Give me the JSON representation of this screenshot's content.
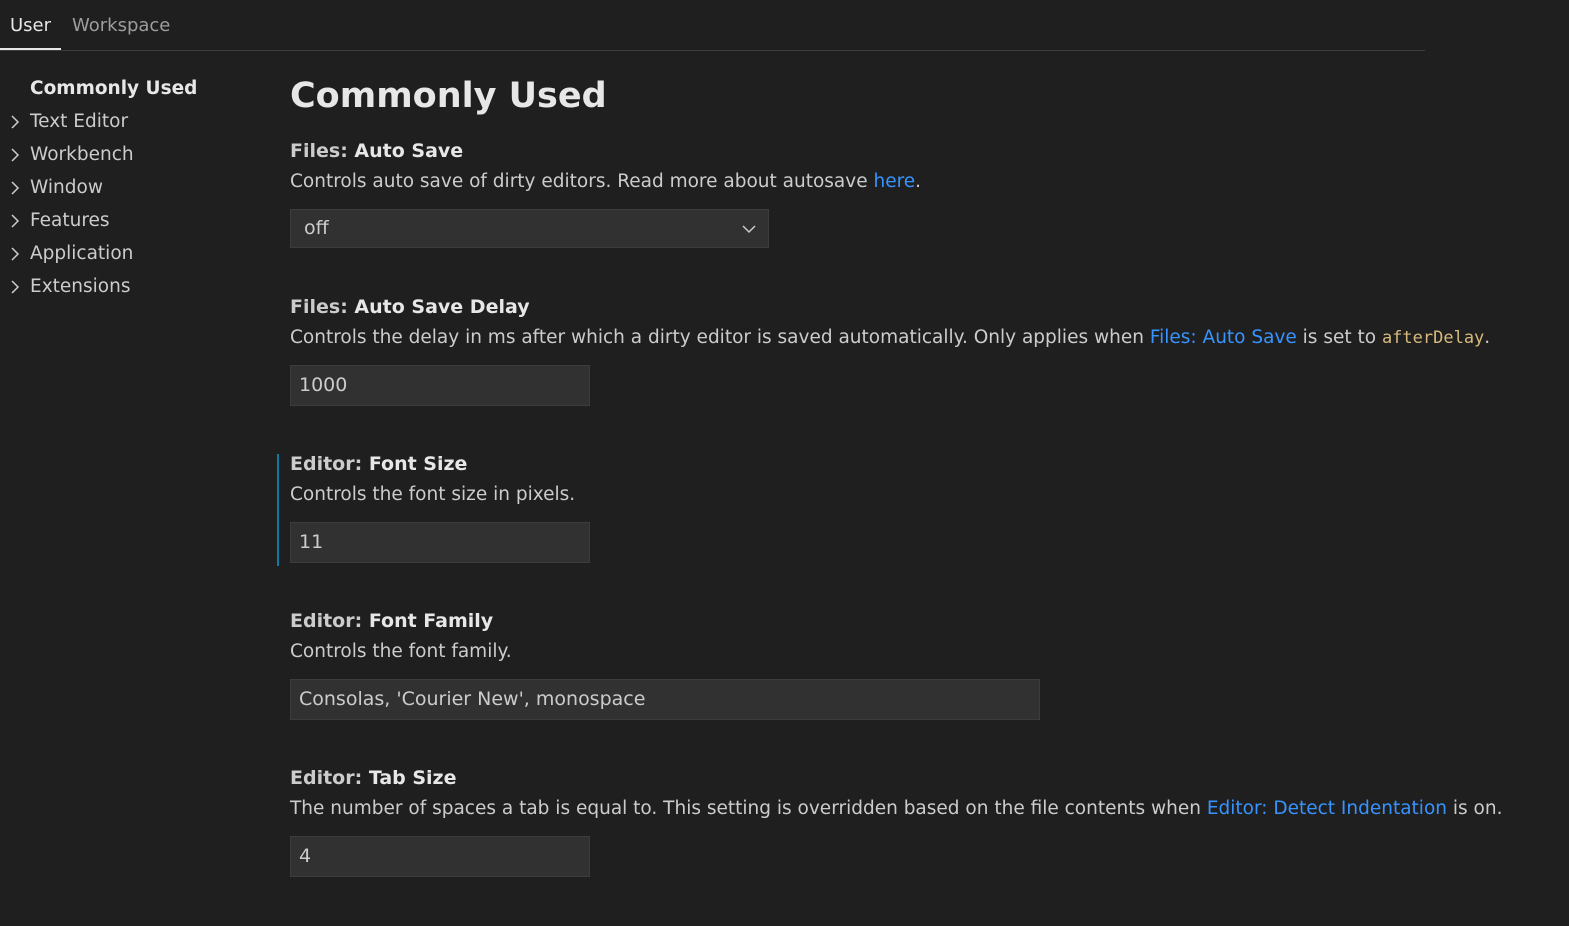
{
  "tabs": [
    {
      "label": "User",
      "active": true
    },
    {
      "label": "Workspace",
      "active": false
    }
  ],
  "toc": {
    "items": [
      {
        "label": "Commonly Used",
        "active": true,
        "icon": null
      },
      {
        "label": "Text Editor",
        "icon": "chevron-right-icon"
      },
      {
        "label": "Workbench",
        "icon": "chevron-right-icon"
      },
      {
        "label": "Window",
        "icon": "chevron-right-icon"
      },
      {
        "label": "Features",
        "icon": "chevron-right-icon"
      },
      {
        "label": "Application",
        "icon": "chevron-right-icon"
      },
      {
        "label": "Extensions",
        "icon": "chevron-right-icon"
      }
    ]
  },
  "main": {
    "title": "Commonly Used",
    "settings": [
      {
        "category": "Files: ",
        "name": "Auto Save",
        "desc_before": "Controls auto save of dirty editors. Read more about autosave ",
        "desc_link": "here",
        "desc_after": ".",
        "control": "dropdown",
        "value": "off"
      },
      {
        "category": "Files: ",
        "name": "Auto Save Delay",
        "desc_before": "Controls the delay in ms after which a dirty editor is saved automatically. Only applies when ",
        "desc_link": "Files: Auto Save",
        "desc_mid": " is set to ",
        "desc_code": "afterDelay",
        "desc_after": ".",
        "control": "input",
        "value": "1000"
      },
      {
        "category": "Editor: ",
        "name": "Font Size",
        "desc": "Controls the font size in pixels.",
        "control": "input",
        "value": "11",
        "focused": true
      },
      {
        "category": "Editor: ",
        "name": "Font Family",
        "desc": "Controls the font family.",
        "control": "input",
        "value": "Consolas, 'Courier New', monospace"
      },
      {
        "category": "Editor: ",
        "name": "Tab Size",
        "desc_before": "The number of spaces a tab is equal to. This setting is overridden based on the file contents when ",
        "desc_link": "Editor: Detect Indentation",
        "desc_after": " is on.",
        "control": "input",
        "value": "4"
      }
    ]
  },
  "colors": {
    "background": "#1f1f1f",
    "link": "#3794ff",
    "code": "#d7ba7d",
    "focus_indicator": "#0e7aa3",
    "input_background": "#313131"
  }
}
